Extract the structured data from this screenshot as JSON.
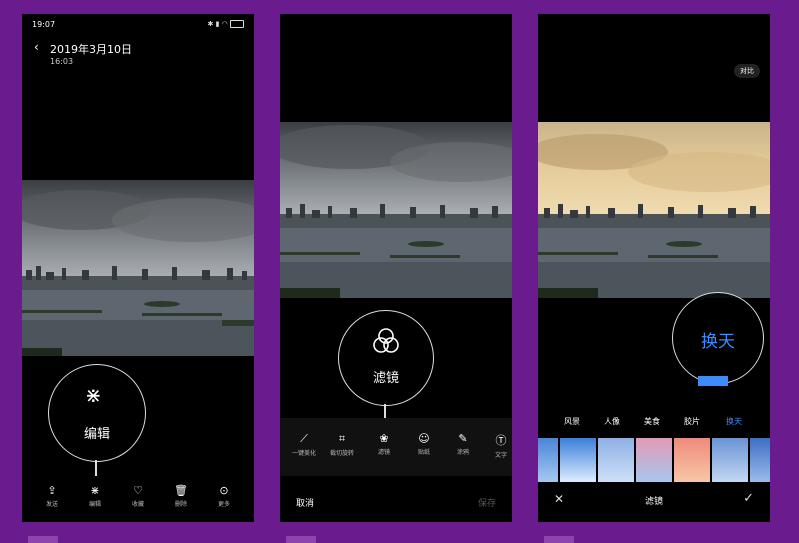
{
  "panel1": {
    "status_time": "19:07",
    "status_icons": [
      "bluetooth-icon",
      "signal-icon",
      "wifi-icon",
      "battery-icon"
    ],
    "date_title": "2019年3月10日",
    "time_subtitle": "16:03",
    "callout_label": "编辑",
    "bottom_actions": [
      {
        "icon": "share-icon",
        "label": "发送"
      },
      {
        "icon": "edit-sparkle-icon",
        "label": "编辑"
      },
      {
        "icon": "heart-icon",
        "label": "收藏"
      },
      {
        "icon": "trash-icon",
        "label": "删除"
      },
      {
        "icon": "more-icon",
        "label": "更多"
      }
    ]
  },
  "panel2": {
    "callout_label": "滤镜",
    "tools": [
      {
        "icon": "magic-wand-icon",
        "label": "一键美化"
      },
      {
        "icon": "crop-rotate-icon",
        "label": "裁切旋转"
      },
      {
        "icon": "filter-icon",
        "label": "滤镜"
      },
      {
        "icon": "sticker-icon",
        "label": "贴纸"
      },
      {
        "icon": "doodle-icon",
        "label": "涂鸦"
      },
      {
        "icon": "text-icon",
        "label": "文字"
      }
    ],
    "cancel_label": "取消",
    "save_label": "保存"
  },
  "panel3": {
    "compare_label": "对比",
    "callout_label": "换天",
    "categories": [
      "风景",
      "人像",
      "美食",
      "胶片",
      "换天"
    ],
    "active_category": "换天",
    "title": "滤镜",
    "close_icon": "close-icon",
    "confirm_icon": "check-icon",
    "colors": {
      "accent": "#3d8bfd"
    }
  }
}
